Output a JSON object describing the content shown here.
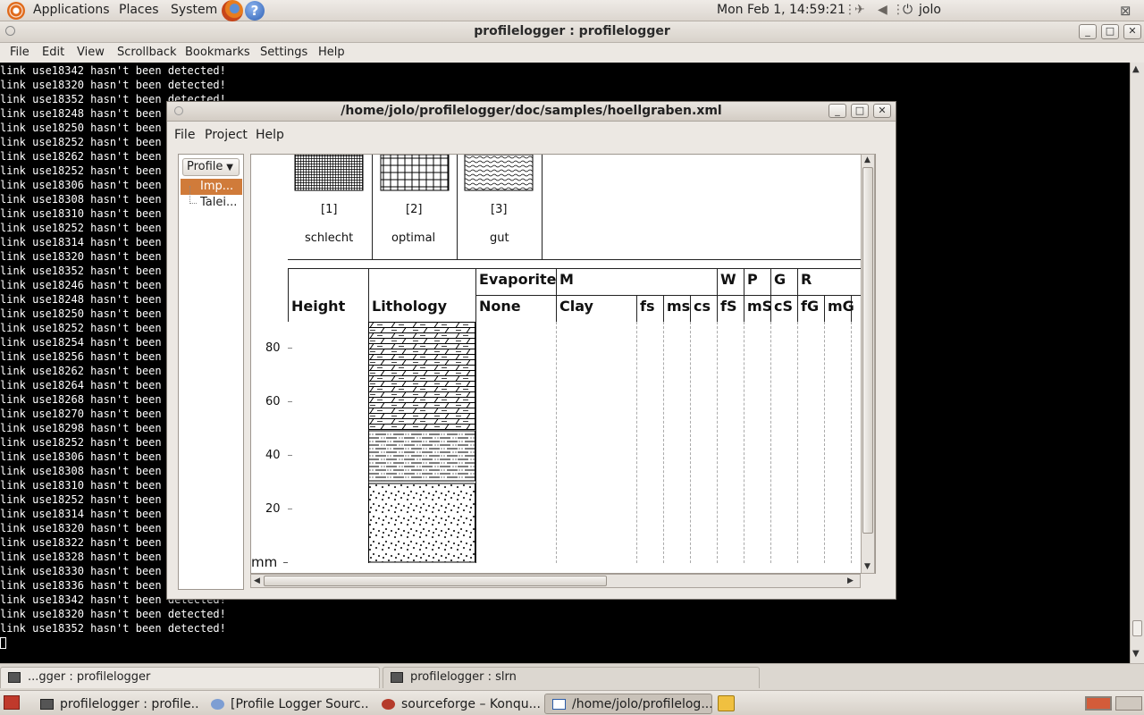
{
  "top_panel": {
    "applications": "Applications",
    "places": "Places",
    "system": "System",
    "clock": "Mon Feb  1, 14:59:21",
    "user": "jolo"
  },
  "konsole": {
    "title": "profilelogger : profilelogger",
    "menu": [
      "File",
      "Edit",
      "View",
      "Scrollback",
      "Bookmarks",
      "Settings",
      "Help"
    ],
    "lines": [
      "link use18342 hasn't been detected!",
      "link use18320 hasn't been detected!",
      "link use18352 hasn't been detected!",
      "link use18248 hasn't been detected!",
      "link use18250 hasn't been detected!",
      "link use18252 hasn't been detected!",
      "link use18262 hasn't been detected!",
      "link use18252 hasn't been detected!",
      "link use18306 hasn't been detected!",
      "link use18308 hasn't been detected!",
      "link use18310 hasn't been detected!",
      "link use18252 hasn't been detected!",
      "link use18314 hasn't been detected!",
      "link use18320 hasn't been detected!",
      "link use18352 hasn't been detected!",
      "link use18246 hasn't been detected!",
      "link use18248 hasn't been detected!",
      "link use18250 hasn't been detected!",
      "link use18252 hasn't been detected!",
      "link use18254 hasn't been detected!",
      "link use18256 hasn't been detected!",
      "link use18262 hasn't been detected!",
      "link use18264 hasn't been detected!",
      "link use18268 hasn't been detected!",
      "link use18270 hasn't been detected!",
      "link use18298 hasn't been detected!",
      "link use18252 hasn't been detected!",
      "link use18306 hasn't been detected!",
      "link use18308 hasn't been detected!",
      "link use18310 hasn't been detected!",
      "link use18252 hasn't been detected!",
      "link use18314 hasn't been detected!",
      "link use18320 hasn't been detected!",
      "link use18322 hasn't been detected!",
      "link use18328 hasn't been detected!",
      "link use18330 hasn't been detected!",
      "link use18336 hasn't been detected!",
      "link use18342 hasn't been detected!",
      "link use18320 hasn't been detected!",
      "link use18352 hasn't been detected!"
    ],
    "tabs": [
      "...gger : profilelogger",
      "profilelogger : slrn"
    ]
  },
  "taskbar": {
    "buttons": [
      "profilelogger : profile...",
      "[Profile Logger Sourc...",
      "sourceforge – Konqu...",
      "/home/jolo/profilelog..."
    ]
  },
  "profilelogger": {
    "title": "/home/jolo/profilelogger/doc/samples/hoellgraben.xml",
    "menu": [
      "File",
      "Project",
      "Help"
    ],
    "profile_select": "Profile",
    "tree_items": [
      "Imp...",
      "Talei..."
    ],
    "legend": [
      {
        "num": "[1]",
        "label": "schlecht"
      },
      {
        "num": "[2]",
        "label": "optimal"
      },
      {
        "num": "[3]",
        "label": "gut"
      }
    ],
    "columns": {
      "height": "Height",
      "lithology": "Lithology",
      "evaporite": "Evaporite",
      "none": "None",
      "m": "M",
      "clay": "Clay",
      "fs": "fs",
      "ms": "ms",
      "cs": "cs",
      "w": "W",
      "fS": "fS",
      "p": "P",
      "mS": "mS",
      "g": "G",
      "cS": "cS",
      "r": "R",
      "fG": "fG",
      "mG": "mG"
    },
    "scale_ticks": [
      "80",
      "60",
      "40",
      "20"
    ],
    "unit": "mm"
  }
}
